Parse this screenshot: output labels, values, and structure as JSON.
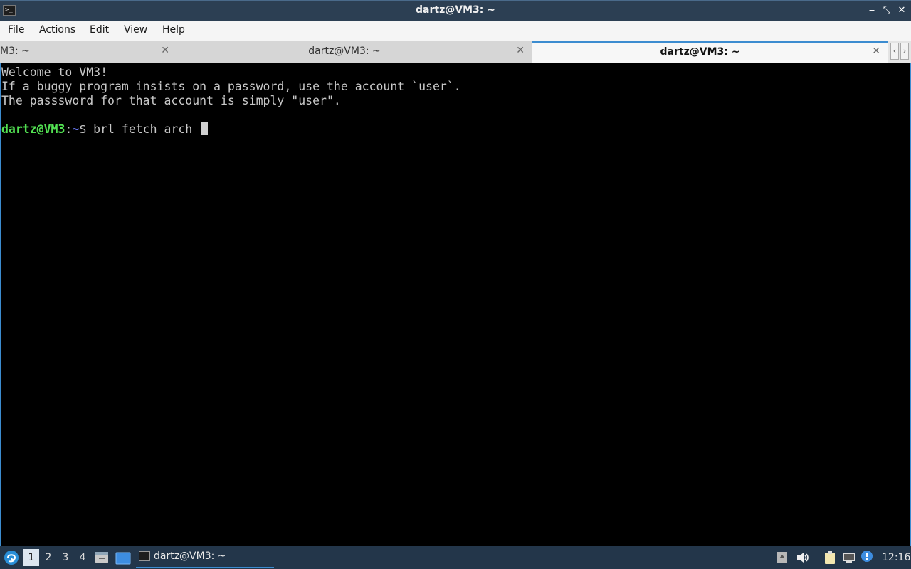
{
  "window": {
    "title": "dartz@VM3: ~",
    "app_icon": "terminal-icon",
    "app_icon_glyph": ">_",
    "minimize_glyph": "‒",
    "maximize_glyph": "⤡",
    "close_glyph": "✕"
  },
  "menu": {
    "file": "File",
    "actions": "Actions",
    "edit": "Edit",
    "view": "View",
    "help": "Help"
  },
  "tabs": [
    {
      "label": "M3: ~",
      "active": false
    },
    {
      "label": "dartz@VM3: ~",
      "active": false
    },
    {
      "label": "dartz@VM3: ~",
      "active": true
    }
  ],
  "tab_close_glyph": "✕",
  "tab_scroll": {
    "left": "‹",
    "right": "›"
  },
  "terminal": {
    "lines": [
      "Welcome to VM3!",
      "If a buggy program insists on a password, use the account `user`.",
      "The passsword for that account is simply \"user\".",
      ""
    ],
    "prompt": {
      "user_host": "dartz@VM3",
      "separator": ":",
      "path": "~",
      "symbol": "$ ",
      "command": "brl fetch arch "
    },
    "colors": {
      "user_host": "#52e052",
      "path": "#6f7fff",
      "text": "#c8c8c8"
    }
  },
  "taskbar": {
    "desktops": [
      "1",
      "2",
      "3",
      "4"
    ],
    "active_desktop": "1",
    "task_label": "dartz@VM3: ~",
    "clock": "12:16"
  },
  "colors": {
    "titlebar": "#2c3f53",
    "accent": "#3c8cd0",
    "taskbar": "#23364a"
  }
}
